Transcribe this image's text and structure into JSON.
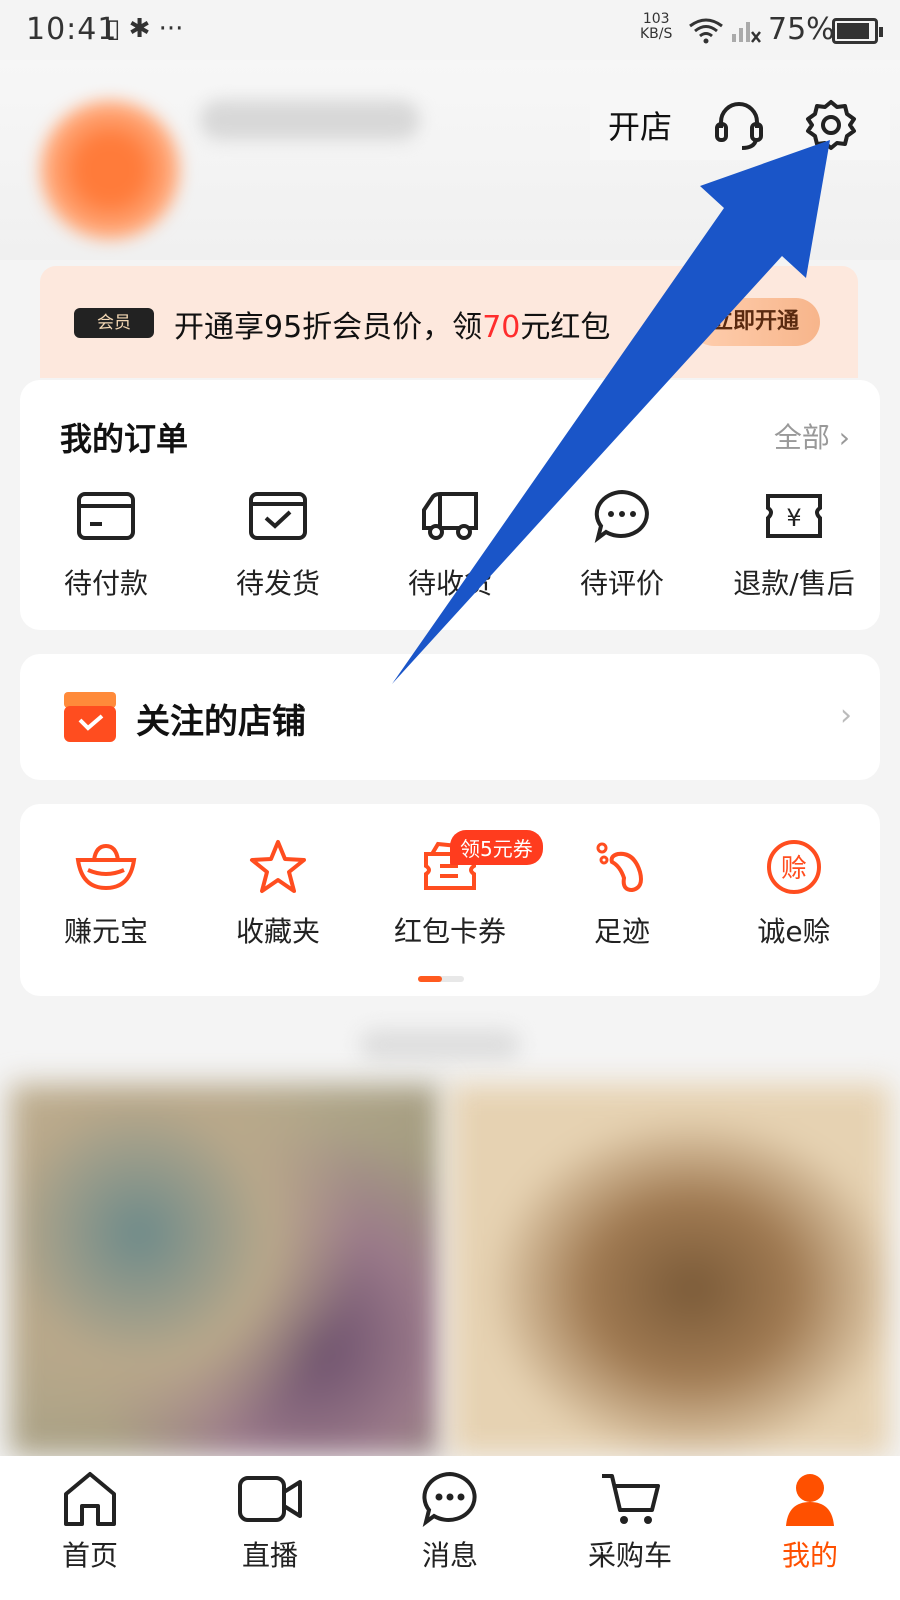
{
  "status_bar": {
    "time": "10:41",
    "icons": "▯ ✱ ···",
    "net_speed_value": "103",
    "net_speed_unit": "KB/S",
    "battery": "75%"
  },
  "header": {
    "open_store": "开店",
    "service_icon": "headset-icon",
    "settings_icon": "gear-icon"
  },
  "member_banner": {
    "badge": "会员",
    "text_before": "开通享95折会员价，领",
    "highlight": "70",
    "text_after": "元红包",
    "button": "立即开通"
  },
  "orders": {
    "title": "我的订单",
    "all_link": "全部 ›",
    "items": [
      {
        "label": "待付款",
        "icon": "wallet-icon"
      },
      {
        "label": "待发货",
        "icon": "box-check-icon"
      },
      {
        "label": "待收货",
        "icon": "truck-icon"
      },
      {
        "label": "待评价",
        "icon": "chat-icon"
      },
      {
        "label": "退款/售后",
        "icon": "refund-icon"
      }
    ]
  },
  "follow": {
    "title": "关注的店铺",
    "chevron": "›"
  },
  "tools": {
    "items": [
      {
        "label": "赚元宝",
        "icon": "ingot-icon"
      },
      {
        "label": "收藏夹",
        "icon": "star-icon"
      },
      {
        "label": "红包卡券",
        "icon": "coupon-icon",
        "badge": "领5元券"
      },
      {
        "label": "足迹",
        "icon": "footprint-icon"
      },
      {
        "label": "诚e赊",
        "icon": "credit-icon",
        "icon_char": "赊"
      }
    ]
  },
  "bottom_nav": {
    "items": [
      {
        "label": "首页",
        "icon": "home-icon"
      },
      {
        "label": "直播",
        "icon": "video-icon"
      },
      {
        "label": "消息",
        "icon": "message-icon"
      },
      {
        "label": "采购车",
        "icon": "cart-icon"
      },
      {
        "label": "我的",
        "icon": "profile-icon",
        "active": true
      }
    ]
  },
  "colors": {
    "accent": "#ff5000",
    "highlight_red": "#ff2d2d",
    "annotation_arrow": "#1a55c8"
  }
}
